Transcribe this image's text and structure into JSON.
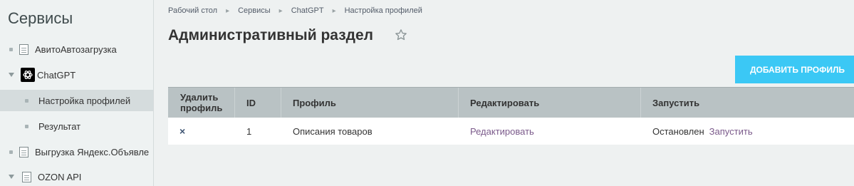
{
  "sidebar": {
    "title": "Сервисы",
    "items": [
      {
        "label": "АвитоАвтозагрузка"
      },
      {
        "label": "ChatGPT"
      },
      {
        "label": "Настройка профилей"
      },
      {
        "label": "Результат"
      },
      {
        "label": "Выгрузка Яндекс.Объявле"
      },
      {
        "label": "OZON API"
      }
    ]
  },
  "breadcrumb": [
    "Рабочий стол",
    "Сервисы",
    "ChatGPT",
    "Настройка профилей"
  ],
  "page": {
    "title": "Административный раздел",
    "add_button": "ДОБАВИТЬ ПРОФИЛЬ"
  },
  "table": {
    "headers": [
      "Удалить профиль",
      "ID",
      "Профиль",
      "Редактировать",
      "Запустить"
    ],
    "rows": [
      {
        "delete": "×",
        "id": "1",
        "profile": "Описания товаров",
        "edit": "Редактировать",
        "status": "Остановлен",
        "run": "Запустить"
      }
    ]
  },
  "colors": {
    "accent": "#3bc8f5",
    "link": "#7b5a8b",
    "header_bg": "#b9c2c4"
  }
}
